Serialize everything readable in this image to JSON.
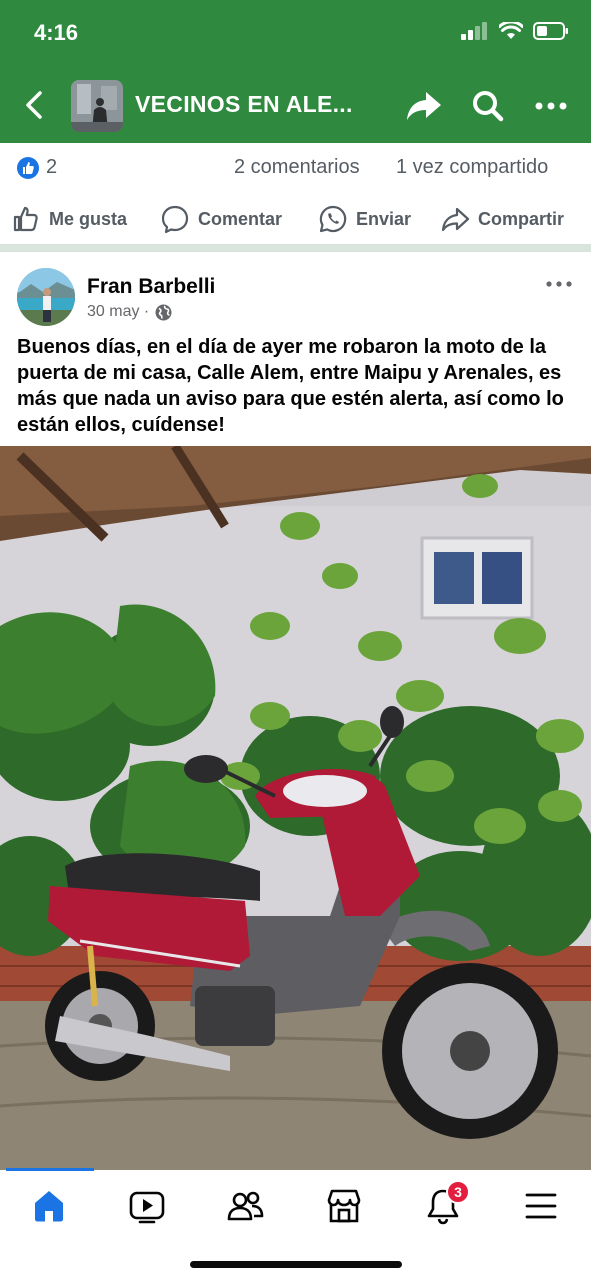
{
  "status_bar": {
    "time": "4:16"
  },
  "nav": {
    "group_title": "VECINOS EN ALE..."
  },
  "engagement": {
    "reaction_count": "2",
    "comments": "2 comentarios",
    "shares": "1 vez compartido"
  },
  "actions": {
    "like": "Me gusta",
    "comment": "Comentar",
    "send": "Enviar",
    "share": "Compartir"
  },
  "post": {
    "author": "Fran Barbelli",
    "date": "30 may · ",
    "text": "Buenos días, en el día de ayer me robaron la moto de la puerta de mi casa, Calle Alem, entre Maipu y Arenales, es más que nada un aviso para que estén alerta, así como lo están ellos, cuídense!"
  },
  "tabbar": {
    "notification_badge": "3",
    "active_tab": "home"
  },
  "colors": {
    "header_green": "#2f8a3f",
    "facebook_blue": "#1b74e4",
    "badge_red": "#e41e3f",
    "motorcycle_red": "#b01a36"
  },
  "icons": [
    "back-icon",
    "share-arrow-icon",
    "search-icon",
    "more-icon",
    "like-icon",
    "comment-icon",
    "whatsapp-icon",
    "share-icon",
    "globe-icon",
    "home-icon",
    "video-icon",
    "friends-icon",
    "marketplace-icon",
    "bell-icon",
    "menu-icon"
  ]
}
